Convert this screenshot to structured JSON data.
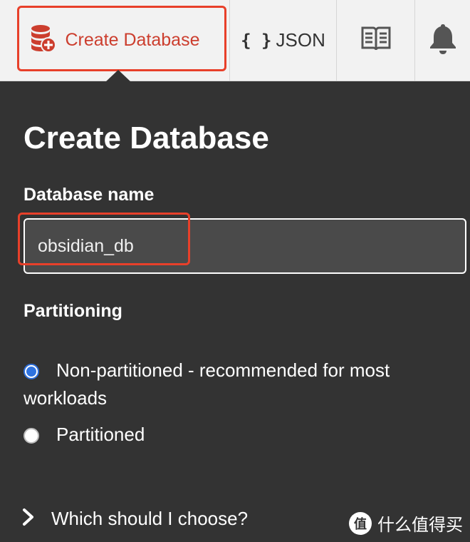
{
  "toolbar": {
    "create_label": "Create Database",
    "json_braces": "{ }",
    "json_label": "JSON",
    "icons": {
      "create": "database-plus-icon",
      "book": "book-icon",
      "bell": "bell-icon"
    }
  },
  "form": {
    "title": "Create Database",
    "name_label": "Database name",
    "name_value": "obsidian_db",
    "partition_label": "Partitioning",
    "options": [
      {
        "label": "Non-partitioned - recommended for most workloads",
        "checked": true
      },
      {
        "label": "Partitioned",
        "checked": false
      }
    ],
    "help_link": "Which should I choose?"
  },
  "watermark": {
    "logo_text": "值",
    "text": "什么值得买"
  },
  "colors": {
    "accent_red": "#e8402a",
    "create_text": "#cc3e2e",
    "panel_bg": "#333333",
    "toolbar_bg": "#f2f2f2",
    "radio_blue": "#2f73e0"
  }
}
